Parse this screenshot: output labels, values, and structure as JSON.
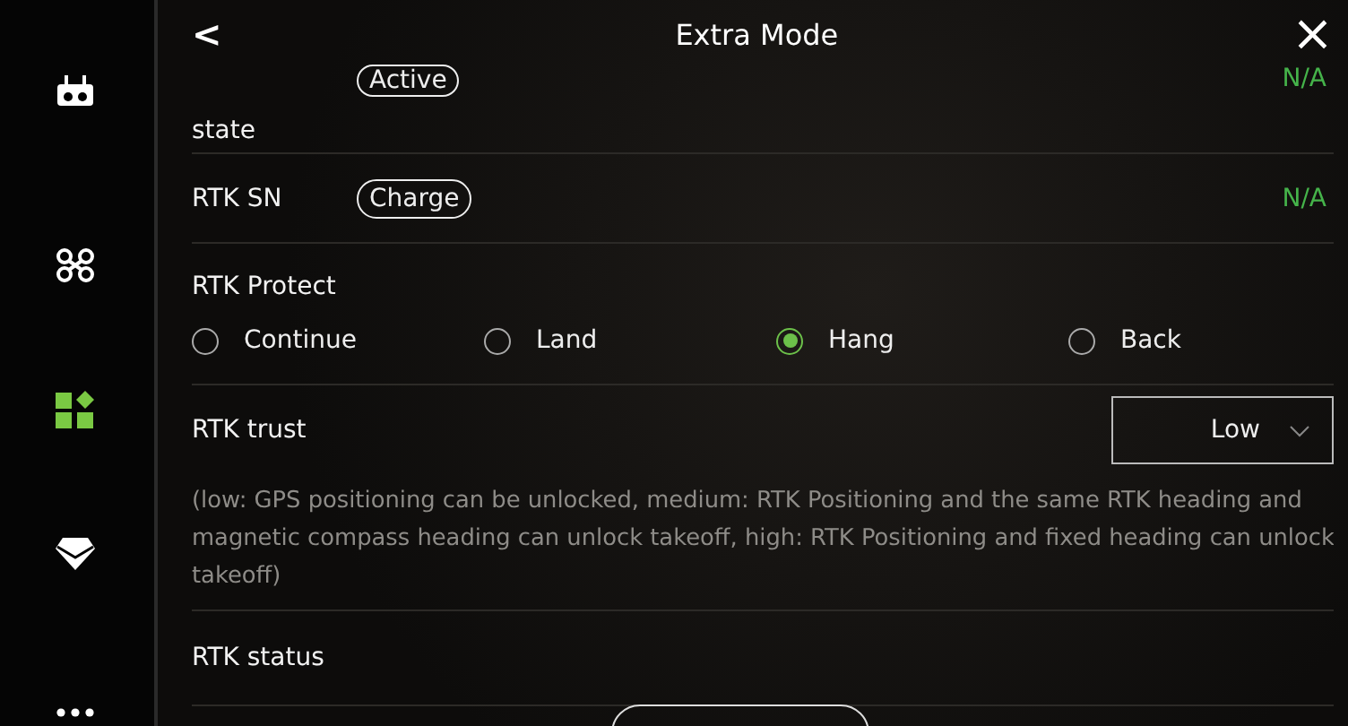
{
  "sidebar": {
    "items": [
      {
        "kind": "controller",
        "selected": false
      },
      {
        "kind": "drone",
        "selected": false
      },
      {
        "kind": "grid",
        "selected": true
      },
      {
        "kind": "diamond",
        "selected": false
      },
      {
        "kind": "more",
        "selected": false
      }
    ]
  },
  "header": {
    "back": "<",
    "title": "Extra Mode",
    "close": "×"
  },
  "rows": [
    {
      "kind": "status",
      "label": "state",
      "tag": "Active",
      "value": "N/A"
    },
    {
      "kind": "status",
      "label": "RTK SN",
      "tag": "Charge",
      "value": "N/A"
    },
    {
      "kind": "radios",
      "label": "RTK Protect",
      "options": [
        {
          "label": "Continue",
          "selected": false
        },
        {
          "label": "Land",
          "selected": false
        },
        {
          "label": "Hang",
          "selected": true
        },
        {
          "label": "Back",
          "selected": false
        }
      ]
    },
    {
      "kind": "select",
      "label": "RTK trust",
      "value": "Low",
      "note": "(low: GPS positioning can be unlocked, medium: RTK Positioning and the same RTK heading and magnetic compass heading can unlock takeoff, high: RTK Positioning and fixed heading can unlock takeoff)"
    },
    {
      "kind": "plain",
      "label": "RTK status"
    }
  ]
}
